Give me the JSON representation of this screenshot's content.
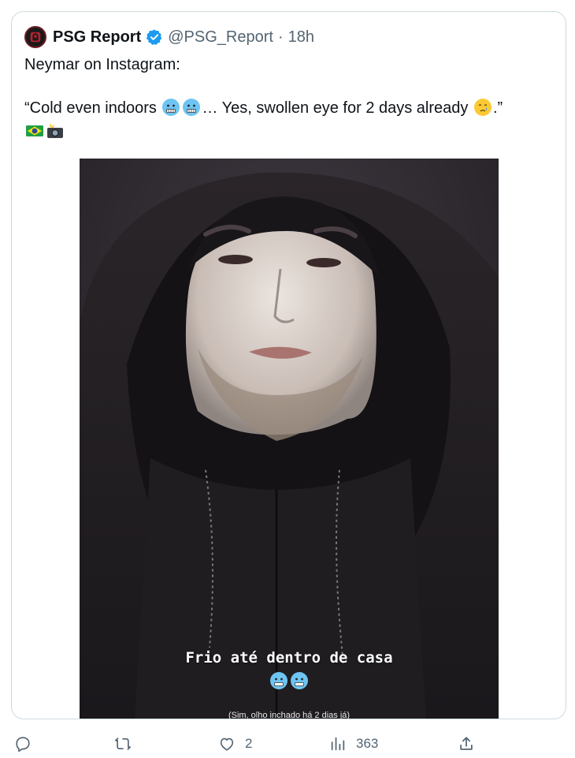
{
  "tweet": {
    "display_name": "PSG Report",
    "handle": "@PSG_Report",
    "separator": "·",
    "time": "18h",
    "text_line1": "Neymar on Instagram:",
    "quote_open": "“Cold even indoors",
    "quote_mid": "… Yes, swollen eye for 2 days already",
    "quote_close": ".”",
    "icons": [
      "cold-face-emoji",
      "cold-face-emoji",
      "crying-face-emoji",
      "brazil-flag-emoji",
      "camera-flash-emoji"
    ]
  },
  "media": {
    "caption": "Frio até dentro de casa",
    "caption_sub": "(Sim, olho inchado há 2 dias já)"
  },
  "actions": {
    "reply_count": "",
    "retweet_count": "",
    "like_count": "2",
    "views_count": "363"
  },
  "colors": {
    "verified": "#1d9bf0",
    "muted": "#536471",
    "border": "#cfd9de"
  }
}
